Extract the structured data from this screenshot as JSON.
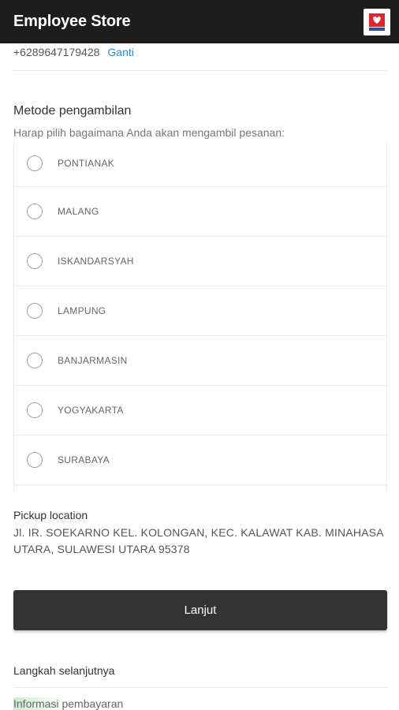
{
  "app": {
    "title": "Employee Store",
    "logo_icon": "store-logo-icon"
  },
  "contact": {
    "phone": "+6289647179428",
    "change_label": "Ganti"
  },
  "pickup_method": {
    "title": "Metode pengambilan",
    "subtitle": "Harap pilih bagaimana Anda akan mengambil pesanan:",
    "options": [
      {
        "label": "PONTIANAK",
        "selected": false
      },
      {
        "label": "MALANG",
        "selected": false
      },
      {
        "label": "ISKANDARSYAH",
        "selected": false
      },
      {
        "label": "LAMPUNG",
        "selected": false
      },
      {
        "label": "BANJARMASIN",
        "selected": false
      },
      {
        "label": "YOGYAKARTA",
        "selected": false
      },
      {
        "label": "SURABAYA",
        "selected": false
      }
    ]
  },
  "pickup_location": {
    "label": "Pickup location",
    "address": "Jl. IR. SOEKARNO KEL. KOLONGAN, KEC. KALAWAT KAB. MINAHASA UTARA, SULAWESI UTARA 95378"
  },
  "actions": {
    "continue_label": "Lanjut"
  },
  "next_steps": {
    "title": "Langkah selanjutnya",
    "item_highlight": "Informasi p",
    "item_rest": "embayaran"
  },
  "colors": {
    "appbar": "#1d1d1d",
    "link": "#2f8bd1",
    "button": "#333333",
    "logo_red": "#e0262c"
  }
}
